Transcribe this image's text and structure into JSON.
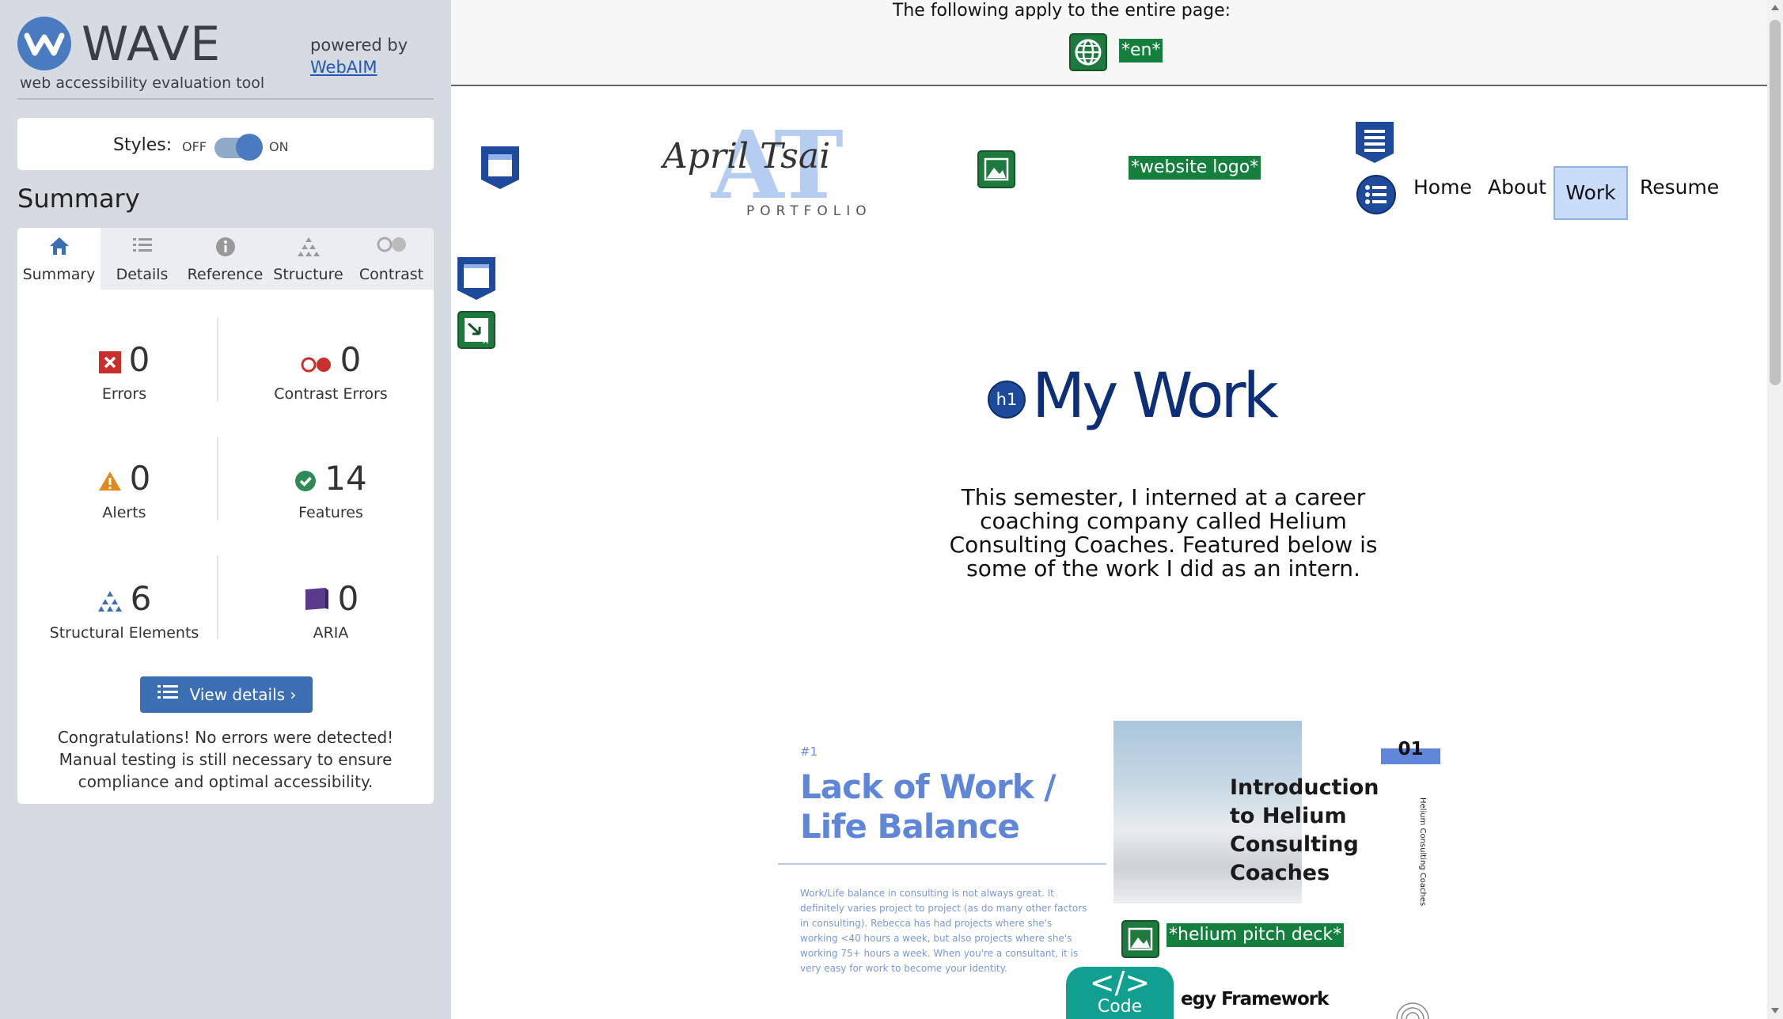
{
  "sidebar": {
    "brand": "WAVE",
    "subtitle": "web accessibility evaluation tool",
    "powered_by": "powered by",
    "webaim_link": "WebAIM",
    "styles_label": "Styles:",
    "styles_off": "OFF",
    "styles_on": "ON",
    "summary_heading": "Summary",
    "tabs": [
      {
        "label": "Summary",
        "icon": "home-icon"
      },
      {
        "label": "Details",
        "icon": "list-icon"
      },
      {
        "label": "Reference",
        "icon": "info-icon"
      },
      {
        "label": "Structure",
        "icon": "hierarchy-icon"
      },
      {
        "label": "Contrast",
        "icon": "contrast-icon"
      }
    ],
    "stats": {
      "errors": {
        "value": "0",
        "label": "Errors"
      },
      "contrast_errors": {
        "value": "0",
        "label": "Contrast Errors"
      },
      "alerts": {
        "value": "0",
        "label": "Alerts"
      },
      "features": {
        "value": "14",
        "label": "Features"
      },
      "structural": {
        "value": "6",
        "label": "Structural Elements"
      },
      "aria": {
        "value": "0",
        "label": "ARIA"
      }
    },
    "view_details": "View details ›",
    "congrats": "Congratulations! No errors were detected! Manual testing is still necessary to ensure compliance and optimal accessibility."
  },
  "page": {
    "banner_text": "The following apply to the entire page:",
    "lang_tag": "*en*",
    "logo_script": "April Tsai",
    "logo_initials": "AT",
    "logo_sub": "PORTFOLIO",
    "logo_alt_tag": "*website logo*",
    "nav": [
      "Home",
      "About",
      "Work",
      "Resume"
    ],
    "h1_badge": "h1",
    "title": "My Work",
    "intro": "This semester, I interned at a career coaching company called Helium Consulting Coaches. Featured below is some of the work I did as an intern.",
    "slide": {
      "num_left": "#1",
      "title_left": "Lack of Work / Life Balance",
      "body_left": "Work/Life balance in consulting is not always great. It definitely varies project to project (as do many other factors in consulting). Rebecca has had projects where she's working <40 hours a week, but also projects where she's working 75+ hours a week. When you're a consultant, it is very easy for work to become your identity.",
      "title_right": "Introduction to Helium Consulting Coaches",
      "num_right": "01",
      "vertical": "Helium Consulting Coaches",
      "strategy": "egy Framework"
    },
    "pitch_tag": "*helium pitch deck*",
    "code_button": {
      "symbol": "</>",
      "label": "Code"
    }
  },
  "colors": {
    "wave_blue": "#3c6eb4",
    "feature_green": "#15803d",
    "structure_blue": "#1d4a9a",
    "error_red": "#c0392b",
    "alert_orange": "#e08a1e",
    "aria_purple": "#5b3a8e",
    "code_teal": "#11a08f"
  }
}
